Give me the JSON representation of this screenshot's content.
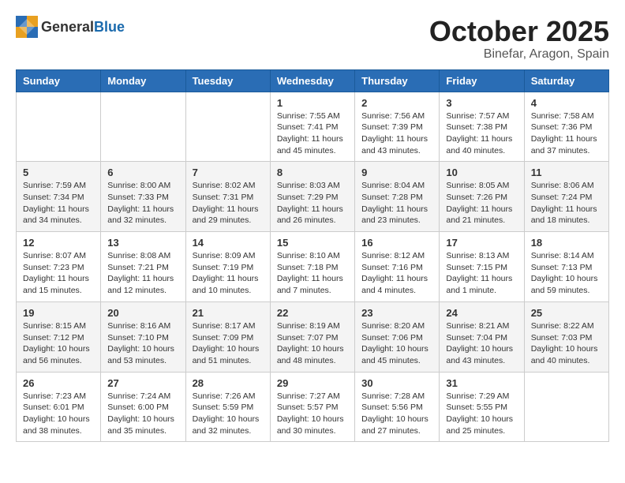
{
  "logo": {
    "general": "General",
    "blue": "Blue"
  },
  "header": {
    "month": "October 2025",
    "location": "Binefar, Aragon, Spain"
  },
  "weekdays": [
    "Sunday",
    "Monday",
    "Tuesday",
    "Wednesday",
    "Thursday",
    "Friday",
    "Saturday"
  ],
  "weeks": [
    [
      {
        "day": "",
        "info": ""
      },
      {
        "day": "",
        "info": ""
      },
      {
        "day": "",
        "info": ""
      },
      {
        "day": "1",
        "info": "Sunrise: 7:55 AM\nSunset: 7:41 PM\nDaylight: 11 hours and 45 minutes."
      },
      {
        "day": "2",
        "info": "Sunrise: 7:56 AM\nSunset: 7:39 PM\nDaylight: 11 hours and 43 minutes."
      },
      {
        "day": "3",
        "info": "Sunrise: 7:57 AM\nSunset: 7:38 PM\nDaylight: 11 hours and 40 minutes."
      },
      {
        "day": "4",
        "info": "Sunrise: 7:58 AM\nSunset: 7:36 PM\nDaylight: 11 hours and 37 minutes."
      }
    ],
    [
      {
        "day": "5",
        "info": "Sunrise: 7:59 AM\nSunset: 7:34 PM\nDaylight: 11 hours and 34 minutes."
      },
      {
        "day": "6",
        "info": "Sunrise: 8:00 AM\nSunset: 7:33 PM\nDaylight: 11 hours and 32 minutes."
      },
      {
        "day": "7",
        "info": "Sunrise: 8:02 AM\nSunset: 7:31 PM\nDaylight: 11 hours and 29 minutes."
      },
      {
        "day": "8",
        "info": "Sunrise: 8:03 AM\nSunset: 7:29 PM\nDaylight: 11 hours and 26 minutes."
      },
      {
        "day": "9",
        "info": "Sunrise: 8:04 AM\nSunset: 7:28 PM\nDaylight: 11 hours and 23 minutes."
      },
      {
        "day": "10",
        "info": "Sunrise: 8:05 AM\nSunset: 7:26 PM\nDaylight: 11 hours and 21 minutes."
      },
      {
        "day": "11",
        "info": "Sunrise: 8:06 AM\nSunset: 7:24 PM\nDaylight: 11 hours and 18 minutes."
      }
    ],
    [
      {
        "day": "12",
        "info": "Sunrise: 8:07 AM\nSunset: 7:23 PM\nDaylight: 11 hours and 15 minutes."
      },
      {
        "day": "13",
        "info": "Sunrise: 8:08 AM\nSunset: 7:21 PM\nDaylight: 11 hours and 12 minutes."
      },
      {
        "day": "14",
        "info": "Sunrise: 8:09 AM\nSunset: 7:19 PM\nDaylight: 11 hours and 10 minutes."
      },
      {
        "day": "15",
        "info": "Sunrise: 8:10 AM\nSunset: 7:18 PM\nDaylight: 11 hours and 7 minutes."
      },
      {
        "day": "16",
        "info": "Sunrise: 8:12 AM\nSunset: 7:16 PM\nDaylight: 11 hours and 4 minutes."
      },
      {
        "day": "17",
        "info": "Sunrise: 8:13 AM\nSunset: 7:15 PM\nDaylight: 11 hours and 1 minute."
      },
      {
        "day": "18",
        "info": "Sunrise: 8:14 AM\nSunset: 7:13 PM\nDaylight: 10 hours and 59 minutes."
      }
    ],
    [
      {
        "day": "19",
        "info": "Sunrise: 8:15 AM\nSunset: 7:12 PM\nDaylight: 10 hours and 56 minutes."
      },
      {
        "day": "20",
        "info": "Sunrise: 8:16 AM\nSunset: 7:10 PM\nDaylight: 10 hours and 53 minutes."
      },
      {
        "day": "21",
        "info": "Sunrise: 8:17 AM\nSunset: 7:09 PM\nDaylight: 10 hours and 51 minutes."
      },
      {
        "day": "22",
        "info": "Sunrise: 8:19 AM\nSunset: 7:07 PM\nDaylight: 10 hours and 48 minutes."
      },
      {
        "day": "23",
        "info": "Sunrise: 8:20 AM\nSunset: 7:06 PM\nDaylight: 10 hours and 45 minutes."
      },
      {
        "day": "24",
        "info": "Sunrise: 8:21 AM\nSunset: 7:04 PM\nDaylight: 10 hours and 43 minutes."
      },
      {
        "day": "25",
        "info": "Sunrise: 8:22 AM\nSunset: 7:03 PM\nDaylight: 10 hours and 40 minutes."
      }
    ],
    [
      {
        "day": "26",
        "info": "Sunrise: 7:23 AM\nSunset: 6:01 PM\nDaylight: 10 hours and 38 minutes."
      },
      {
        "day": "27",
        "info": "Sunrise: 7:24 AM\nSunset: 6:00 PM\nDaylight: 10 hours and 35 minutes."
      },
      {
        "day": "28",
        "info": "Sunrise: 7:26 AM\nSunset: 5:59 PM\nDaylight: 10 hours and 32 minutes."
      },
      {
        "day": "29",
        "info": "Sunrise: 7:27 AM\nSunset: 5:57 PM\nDaylight: 10 hours and 30 minutes."
      },
      {
        "day": "30",
        "info": "Sunrise: 7:28 AM\nSunset: 5:56 PM\nDaylight: 10 hours and 27 minutes."
      },
      {
        "day": "31",
        "info": "Sunrise: 7:29 AM\nSunset: 5:55 PM\nDaylight: 10 hours and 25 minutes."
      },
      {
        "day": "",
        "info": ""
      }
    ]
  ]
}
